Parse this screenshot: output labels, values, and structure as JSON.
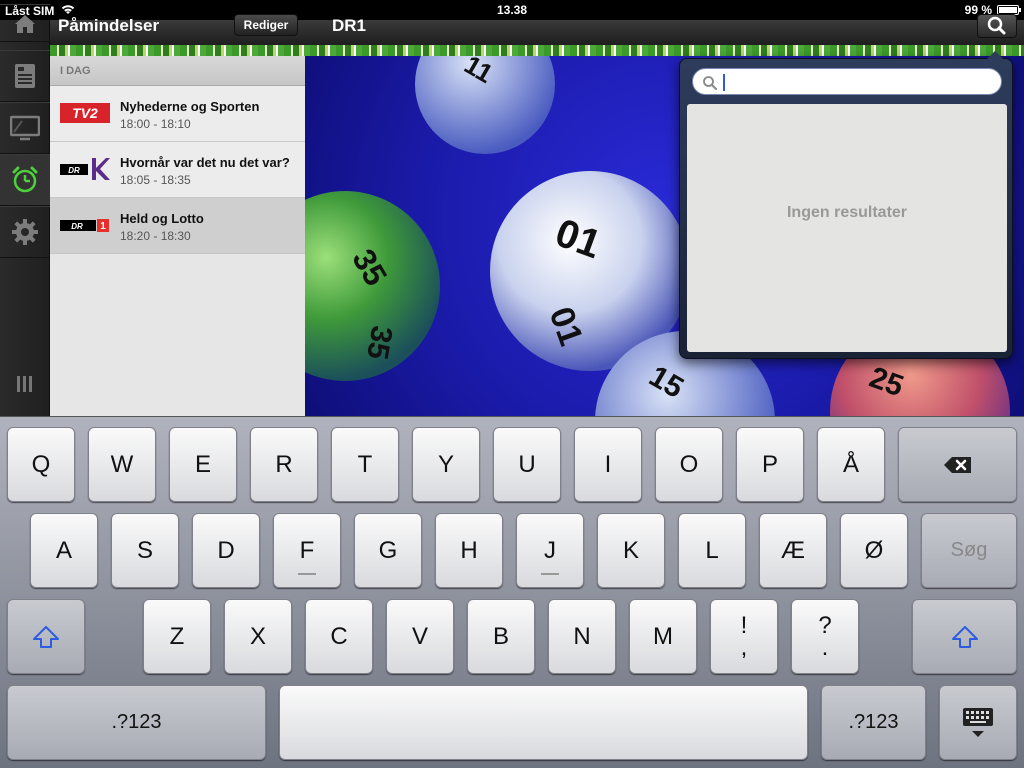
{
  "status_bar": {
    "carrier": "Låst SIM",
    "time": "13.38",
    "battery": "99 %",
    "battery_level": 0.99
  },
  "header": {
    "left_title": "Påmindelser",
    "edit_label": "Rediger",
    "main_title": "DR1"
  },
  "sidebar": {
    "items": [
      {
        "icon": "home-icon"
      },
      {
        "icon": "tv-guide-icon"
      },
      {
        "icon": "tv-icon"
      },
      {
        "icon": "alarm-clock-icon",
        "active": true
      },
      {
        "icon": "gear-icon"
      }
    ]
  },
  "reminders": {
    "section_label": "I DAG",
    "items": [
      {
        "channel": "TV2",
        "title": "Nyhederne og Sporten",
        "time": "18:00 - 18:10"
      },
      {
        "channel": "DR K",
        "title": "Hvornår var det nu det var?",
        "time": "18:05 - 18:35"
      },
      {
        "channel": "DR 1",
        "title": "Held og Lotto",
        "time": "18:20 - 18:30",
        "selected": true
      }
    ]
  },
  "search": {
    "value": "",
    "no_results": "Ingen resultater"
  },
  "keyboard": {
    "row1": [
      "Q",
      "W",
      "E",
      "R",
      "T",
      "Y",
      "U",
      "I",
      "O",
      "P",
      "Å"
    ],
    "row2": [
      "A",
      "S",
      "D",
      "F",
      "G",
      "H",
      "J",
      "K",
      "L",
      "Æ",
      "Ø"
    ],
    "search_key": "Søg",
    "row3": [
      "Z",
      "X",
      "C",
      "V",
      "B",
      "N",
      "M"
    ],
    "punct1_top": "!",
    "punct1_bottom": ",",
    "punct2_top": "?",
    "punct2_bottom": ".",
    "numbers_key": ".?123"
  },
  "colors": {
    "accent_stripe": "#3c9a2a",
    "hero_background": "#2020c0",
    "popover": "#2e3c5c"
  }
}
